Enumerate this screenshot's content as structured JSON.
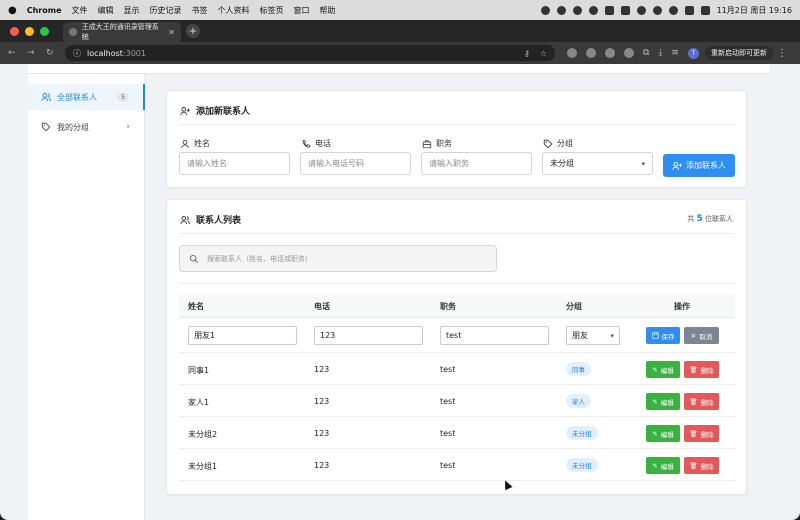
{
  "menubar": {
    "app": "Chrome",
    "items": [
      "文件",
      "编辑",
      "显示",
      "历史记录",
      "书签",
      "个人资料",
      "标签页",
      "窗口",
      "帮助"
    ],
    "clock": "11月2日 周日  19:16"
  },
  "browser": {
    "tab_title": "王成大王的通讯录管理系统",
    "url_host": "localhost",
    "url_port": ":3001",
    "avatar_letter": "T",
    "relaunch_label": "重新启动即可更新"
  },
  "sidebar": {
    "items": [
      {
        "label": "全部联系人",
        "count": "5",
        "active": true
      },
      {
        "label": "我的分组"
      }
    ]
  },
  "add_form": {
    "title": "添加新联系人",
    "name_label": "姓名",
    "name_placeholder": "请输入姓名",
    "phone_label": "电话",
    "phone_placeholder": "请输入电话号码",
    "job_label": "职务",
    "job_placeholder": "请输入职务",
    "group_label": "分组",
    "group_value": "未分组",
    "submit_label": "添加联系人"
  },
  "list": {
    "title": "联系人列表",
    "total_prefix": "共",
    "total_count": "5",
    "total_suffix": "位联系人",
    "search_placeholder": "搜索联系人（姓名、电话或职务）",
    "headers": [
      "姓名",
      "电话",
      "职务",
      "分组",
      "操作"
    ],
    "editing_row": {
      "name": "朋友1",
      "phone": "123",
      "job": "test",
      "group": "朋友",
      "save_label": "保存",
      "cancel_label": "取消"
    },
    "rows": [
      {
        "name": "同事1",
        "phone": "123",
        "job": "test",
        "group": "同事"
      },
      {
        "name": "家人1",
        "phone": "123",
        "job": "test",
        "group": "家人"
      },
      {
        "name": "未分组2",
        "phone": "123",
        "job": "test",
        "group": "未分组"
      },
      {
        "name": "未分组1",
        "phone": "123",
        "job": "test",
        "group": "未分组"
      }
    ],
    "edit_label": "编辑",
    "delete_label": "删除"
  },
  "colors": {
    "accent": "#2f8ef0",
    "edit_green": "#3cb043",
    "delete_red": "#e05a5a",
    "cancel_gray": "#7d8590"
  }
}
